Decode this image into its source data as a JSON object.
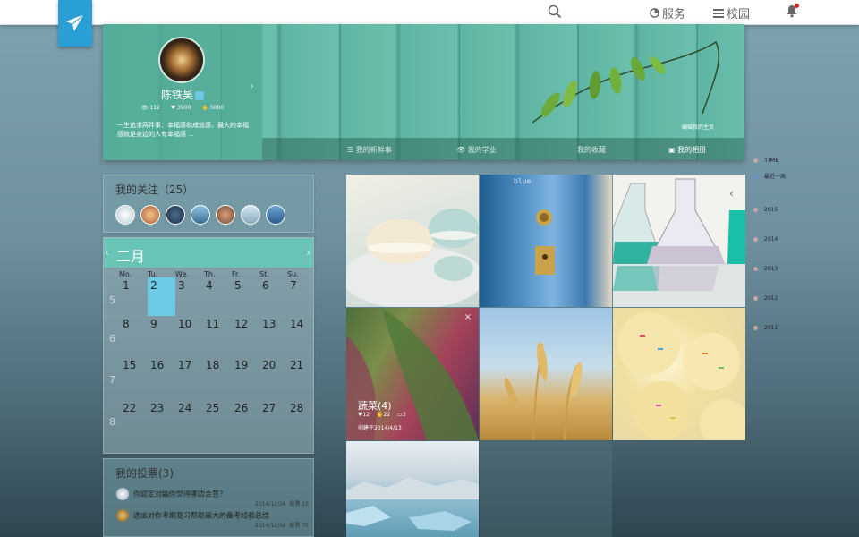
{
  "topbar": {
    "service_label": "服务",
    "campus_label": "校园"
  },
  "profile": {
    "name": "陈铁昊",
    "views": "112",
    "likes": "3900",
    "thumbs": "5000",
    "motto": "一生追求两件事：幸福感和成就感，最大的幸福感就是身边的人有幸福感 ..."
  },
  "banner": {
    "edit_link": "编辑我的主页",
    "tabs": [
      "我的新鲜事",
      "我的学业",
      "我的收藏",
      "我的相册"
    ]
  },
  "follow": {
    "title": "我的关注（25）",
    "faces": [
      "微信",
      "微信",
      "微信",
      "微信",
      "个人",
      "个人",
      "微信"
    ]
  },
  "calendar": {
    "month": "二月",
    "weekdays": [
      "Mo.",
      "Tu.",
      "We.",
      "Th.",
      "Fr.",
      "St.",
      "Su."
    ],
    "weeks": [
      "5",
      "6",
      "7",
      "8"
    ],
    "rows": [
      [
        "1",
        "2",
        "3",
        "4",
        "5",
        "6",
        "7"
      ],
      [
        "8",
        "9",
        "10",
        "11",
        "12",
        "13",
        "14"
      ],
      [
        "15",
        "16",
        "17",
        "18",
        "19",
        "20",
        "21"
      ],
      [
        "22",
        "23",
        "24",
        "25",
        "26",
        "27",
        "28"
      ]
    ],
    "today": "2"
  },
  "votes": {
    "title": "我的投票(3)",
    "items": [
      {
        "text": "你認定对鼬你觉得哪边合意？",
        "date": "2014/12/26",
        "count": "投票 15"
      },
      {
        "text": "选出对你考期复习帮助最大的备考经验总结",
        "date": "2014/12/16",
        "count": "投票 75"
      }
    ]
  },
  "album": {
    "title": "蔬菜(4)",
    "likes": "12",
    "thumbs": "22",
    "comments": "3",
    "created": "创建于2014/4/13",
    "door_text": "blue"
  },
  "timeline": [
    "TIME",
    "最近一周",
    "2015",
    "2014",
    "2013",
    "2012",
    "2011"
  ],
  "colors": {
    "accent": "#6ac4b6",
    "today": "#6dcbe6",
    "logo": "#2a9fd6"
  }
}
